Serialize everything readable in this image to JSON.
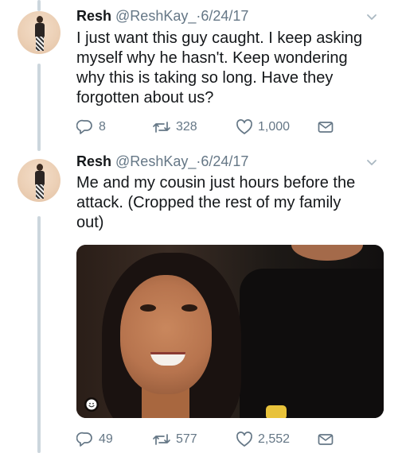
{
  "tweets": [
    {
      "name": "Resh",
      "handle": "@ReshKay_",
      "separator": "·",
      "date": "6/24/17",
      "text": "I just want this guy caught. I keep asking\nmyself why he hasn't. Keep wondering\nwhy this is taking so long. Have they\nforgotten about us?",
      "replies": "8",
      "retweets": "328",
      "likes": "1,000"
    },
    {
      "name": "Resh",
      "handle": "@ReshKay_",
      "separator": "·",
      "date": "6/24/17",
      "text": "Me and my cousin just hours before the\nattack. (Cropped the rest of my family\nout)",
      "replies": "49",
      "retweets": "577",
      "likes": "2,552"
    }
  ],
  "icons": {
    "reply": "reply-icon",
    "retweet": "retweet-icon",
    "like": "heart-icon",
    "dm": "envelope-icon",
    "caret": "chevron-down-icon",
    "sticker": "smiley-icon"
  },
  "colors": {
    "text": "#14171a",
    "secondary": "#657786",
    "thread_line": "#ccd6dd"
  }
}
